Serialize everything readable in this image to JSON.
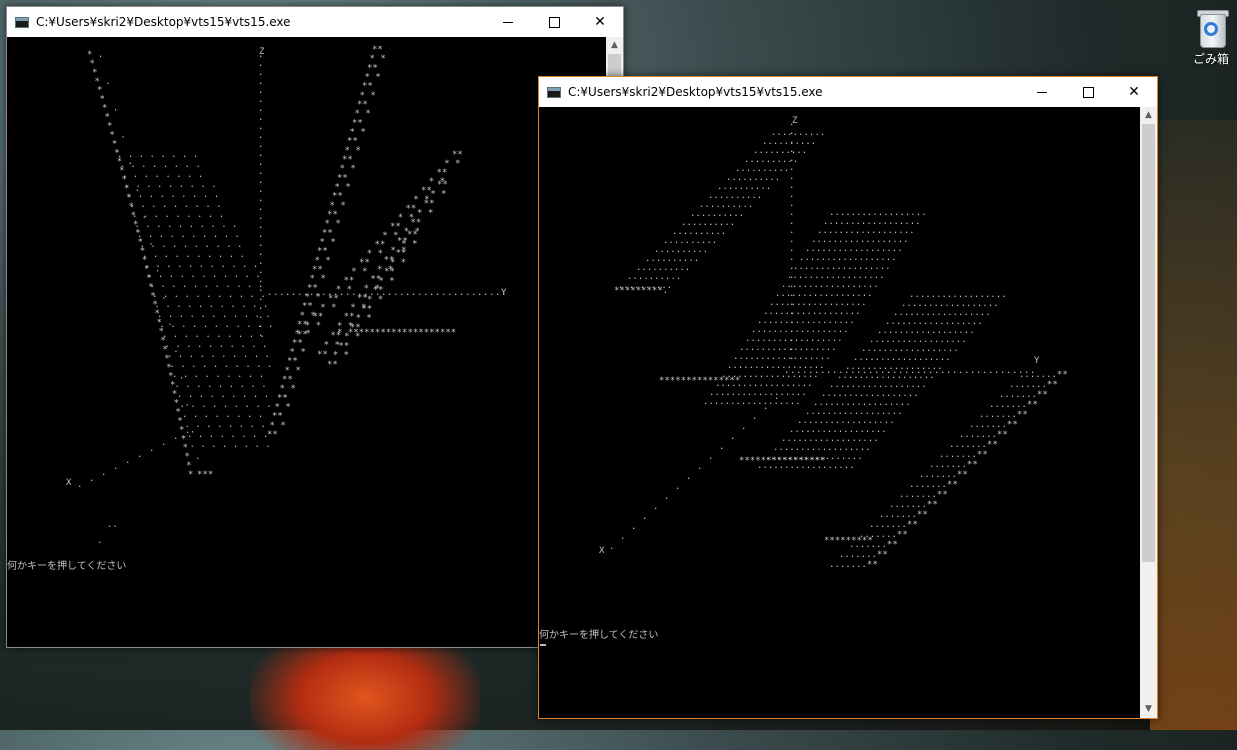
{
  "desktop": {
    "recycle_bin_label": "ごみ箱"
  },
  "window1": {
    "title": "C:¥Users¥skri2¥Desktop¥vts15¥vts15.exe",
    "prompt": "何かキーを押してください",
    "axis_labels": {
      "z": "Z",
      "x": "X",
      "y": "Y"
    }
  },
  "window2": {
    "title": "C:¥Users¥skri2¥Desktop¥vts15¥vts15.exe",
    "prompt": "何かキーを押してください",
    "axis_labels": {
      "z": "Z",
      "x": "X",
      "y": "Y"
    }
  },
  "controls": {
    "minimize": "—",
    "maximize": "☐",
    "close": "✕"
  },
  "colors": {
    "console_bg": "#000000",
    "console_text": "#c0c0c0",
    "active_border": "#d9822b"
  }
}
